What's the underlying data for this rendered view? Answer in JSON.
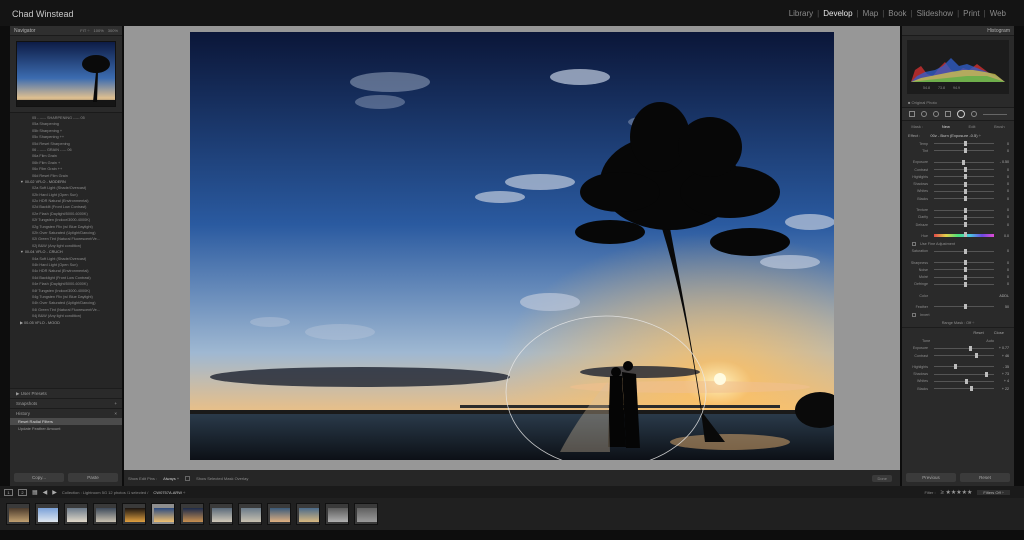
{
  "app": {
    "identity_plate": "Chad Winstead",
    "modules": [
      "Library",
      "Develop",
      "Map",
      "Book",
      "Slideshow",
      "Print",
      "Web"
    ],
    "active_module": "Develop"
  },
  "navigator": {
    "title": "Navigator",
    "zoom": "FIT ÷",
    "zoom_options": [
      "100%",
      "300%"
    ]
  },
  "presets": [
    {
      "label": "05 - ----- SHARPENING ----- 05",
      "folder": false
    },
    {
      "label": "05a Sharpening",
      "folder": false
    },
    {
      "label": "05b Sharpening +",
      "folder": false
    },
    {
      "label": "05c Sharpening ++",
      "folder": false
    },
    {
      "label": "05d Reset Sharpening",
      "folder": false
    },
    {
      "label": "06 - ----- GRAIN ----- 06",
      "folder": false
    },
    {
      "label": "06a Film Grain",
      "folder": false
    },
    {
      "label": "06b Film Grain +",
      "folder": false
    },
    {
      "label": "06c Film Grain ++",
      "folder": false
    },
    {
      "label": "06d Reset Film Grain",
      "folder": false
    },
    {
      "label": "▼ 00-02 VFLO - MODERN",
      "folder": true
    },
    {
      "label": "02a Soft Light (Shade/Overcast)",
      "folder": false
    },
    {
      "label": "02b Hard Light (Open Sun)",
      "folder": false
    },
    {
      "label": "02c HDR Natural (Environmental)",
      "folder": false
    },
    {
      "label": "02d Backlit (Front Low Contrast)",
      "folder": false
    },
    {
      "label": "02e Flash (Daylight/5000-6000K)",
      "folder": false
    },
    {
      "label": "02f Tungsten (Indoor/3000-4000K)",
      "folder": false
    },
    {
      "label": "02g Tungsten Flix (w/ Blue Daylight)",
      "folder": false
    },
    {
      "label": "02h Over Saturated (Uplight/Dancing)",
      "folder": false
    },
    {
      "label": "02i Green Tint (Natural Fluorescent/Ve...",
      "folder": false
    },
    {
      "label": "02j B&W (Any light condition)",
      "folder": false
    },
    {
      "label": "▼ 00-04 VFLO - CRUCH",
      "folder": true
    },
    {
      "label": "04a Soft Light (Shade/Overcast)",
      "folder": false
    },
    {
      "label": "04b Hard Light (Open Sun)",
      "folder": false
    },
    {
      "label": "04c HDR Natural (Environmental)",
      "folder": false
    },
    {
      "label": "04d Backlight (Front Low Contrast)",
      "folder": false
    },
    {
      "label": "04e Flash (Daylight/5000-6000K)",
      "folder": false
    },
    {
      "label": "04f Tungsten (Indoor/3000-4000K)",
      "folder": false
    },
    {
      "label": "04g Tungsten Flix (w/ Blue Daylight)",
      "folder": false
    },
    {
      "label": "04h Over Saturated (Uplight/Dancing)",
      "folder": false
    },
    {
      "label": "04i Green Tint (Natural Fluorescent/Ve...",
      "folder": false
    },
    {
      "label": "04j B&W (Any light condition)",
      "folder": false
    },
    {
      "label": "▶ 00-05 VFLO - MOOD",
      "folder": true
    }
  ],
  "left_sections": {
    "user_presets": "▶ User Presets",
    "snapshots": "Snapshots",
    "history": "History",
    "snapshots_add": "+",
    "history_close": "×"
  },
  "history": [
    "Reset Radial Filters",
    "Update Feather Amount"
  ],
  "left_buttons": {
    "copy": "Copy...",
    "paste": "Paste"
  },
  "histogram": {
    "title": "Histogram",
    "iso": "",
    "readouts": [
      "54.8",
      "73.8",
      "94.9"
    ],
    "original_photo": "■ Original Photo"
  },
  "mask": {
    "tabs": [
      "Mask :",
      "New",
      "Edit",
      "Brush"
    ],
    "active_tab": "New",
    "effect_label": "Effect :",
    "effect_value": "00z - Burn (Exposure -0.5) ÷"
  },
  "sliders": [
    {
      "label": "Temp",
      "value": "0",
      "pos": 0.5
    },
    {
      "label": "Tint",
      "value": "0",
      "pos": 0.5
    },
    {
      "gap": true
    },
    {
      "label": "Exposure",
      "value": "- 0.50",
      "pos": 0.47
    },
    {
      "label": "Contrast",
      "value": "0",
      "pos": 0.5
    },
    {
      "label": "Highlights",
      "value": "0",
      "pos": 0.5
    },
    {
      "label": "Shadows",
      "value": "0",
      "pos": 0.5
    },
    {
      "label": "Whites",
      "value": "0",
      "pos": 0.5
    },
    {
      "label": "Blacks",
      "value": "0",
      "pos": 0.5
    },
    {
      "gap": true
    },
    {
      "label": "Texture",
      "value": "0",
      "pos": 0.5
    },
    {
      "label": "Clarity",
      "value": "0",
      "pos": 0.5
    },
    {
      "label": "Dehaze",
      "value": "0",
      "pos": 0.5
    },
    {
      "gap": true
    },
    {
      "label": "Hue",
      "value": "0.0",
      "pos": 0.5,
      "hue": true
    }
  ],
  "fine_adjust": "Use Fine Adjustment",
  "sliders2": [
    {
      "label": "Saturation",
      "value": "0",
      "pos": 0.5
    },
    {
      "gap": true
    },
    {
      "label": "Sharpness",
      "value": "0",
      "pos": 0.5
    },
    {
      "label": "Noise",
      "value": "0",
      "pos": 0.5
    },
    {
      "label": "Moiré",
      "value": "0",
      "pos": 0.5
    },
    {
      "label": "Defringe",
      "value": "0",
      "pos": 0.5
    },
    {
      "gap": true
    },
    {
      "label": "Color",
      "value": "ADDL",
      "pos": null
    }
  ],
  "feather": {
    "label": "Feather",
    "value": "50",
    "pos": 0.5
  },
  "invert": "Invert",
  "range_mask": "Range Mask : Off ÷",
  "reset_close": {
    "reset": "Reset",
    "close": "Close"
  },
  "basic": {
    "tone": "Tone",
    "auto": "Auto",
    "sliders": [
      {
        "label": "Exposure",
        "value": "+ 0.77",
        "pos": 0.58
      },
      {
        "label": "Contrast",
        "value": "+ 46",
        "pos": 0.68
      },
      {
        "gap": true
      },
      {
        "label": "Highlights",
        "value": "- 35",
        "pos": 0.34
      },
      {
        "label": "Shadows",
        "value": "+ 73",
        "pos": 0.85
      },
      {
        "label": "Whites",
        "value": "+ 4",
        "pos": 0.52
      },
      {
        "label": "Blacks",
        "value": "+ 22",
        "pos": 0.6
      }
    ]
  },
  "right_buttons": {
    "previous": "Previous",
    "reset": "Reset"
  },
  "toolbar": {
    "show_edit_pins": "Show Edit Pins :",
    "show_edit_pins_value": "Always ÷",
    "show_overlay": "Show Selected Mask Overlay",
    "done": "Done"
  },
  "filmstrip": {
    "page1": "1",
    "page2": "2",
    "collection_info": "Collection : Lightroom 5G    12 photos /1 selected /",
    "filename": "CW0757A.ARW ÷",
    "filter_label": "Filter :",
    "filter_value": "Filters Off ÷",
    "thumbnails": [
      {
        "colors": [
          "#4a3a2c",
          "#c0a070"
        ]
      },
      {
        "colors": [
          "#7aa0d8",
          "#dfe6ef"
        ]
      },
      {
        "colors": [
          "#6b7a8a",
          "#e0d8c8"
        ]
      },
      {
        "colors": [
          "#3e4a5a",
          "#c8c0b0"
        ]
      },
      {
        "colors": [
          "#1b1410",
          "#e0a040"
        ]
      },
      {
        "colors": [
          "#2b4a80",
          "#f0c070"
        ]
      },
      {
        "colors": [
          "#1c2a4a",
          "#c89050"
        ]
      },
      {
        "colors": [
          "#5a6a7a",
          "#d0c8b8"
        ]
      },
      {
        "colors": [
          "#6a7a8a",
          "#c8c0b0"
        ]
      },
      {
        "colors": [
          "#3a5a7a",
          "#e0b080"
        ]
      },
      {
        "colors": [
          "#4a6a8a",
          "#d8b880"
        ]
      },
      {
        "colors": [
          "#5a5a5a",
          "#b0b0b0"
        ]
      },
      {
        "colors": [
          "#606060",
          "#9a9a9a"
        ]
      }
    ],
    "selected_index": 5
  },
  "colors": {
    "sky_top": "#0b1638",
    "sky_mid": "#2a5aa0",
    "sky_low": "#c8d4e0",
    "sunset": "#f0b060",
    "panel": "#2a2a2a"
  }
}
